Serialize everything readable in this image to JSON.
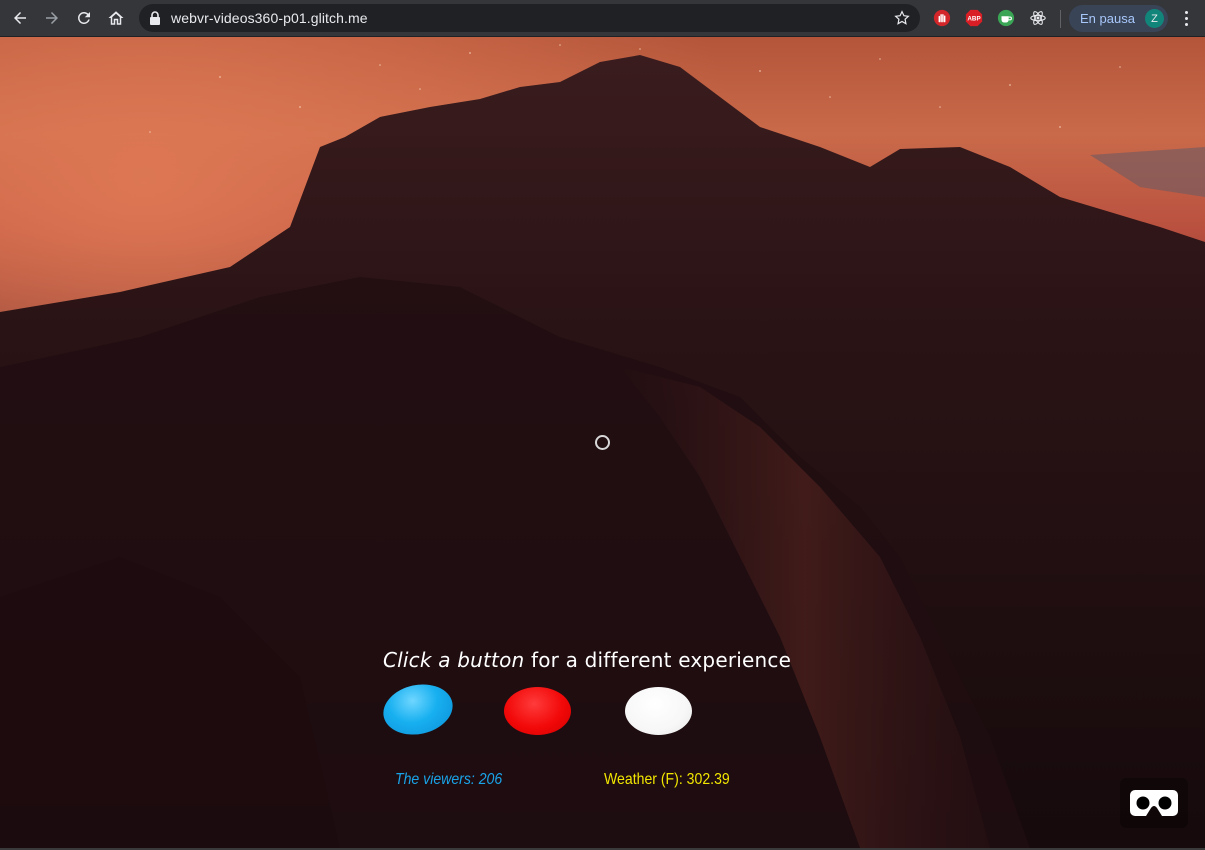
{
  "browser": {
    "url": "webvr-videos360-p01.glitch.me",
    "profile": {
      "label": "En pausa",
      "avatar_letter": "Z"
    },
    "extensions": [
      "stop-hand-icon",
      "adblock-plus-icon",
      "coffee-cup-icon",
      "react-devtools-icon"
    ]
  },
  "scene": {
    "prompt_italic": "Click a button",
    "prompt_rest": " for a different experience",
    "buttons": [
      {
        "name": "blue-experience-button",
        "color": "#18b0f0"
      },
      {
        "name": "red-experience-button",
        "color": "#f20808"
      },
      {
        "name": "white-experience-button",
        "color": "#ffffff"
      }
    ],
    "viewers_text": "The viewers: 206",
    "weather_text": "Weather (F): 302.39"
  }
}
